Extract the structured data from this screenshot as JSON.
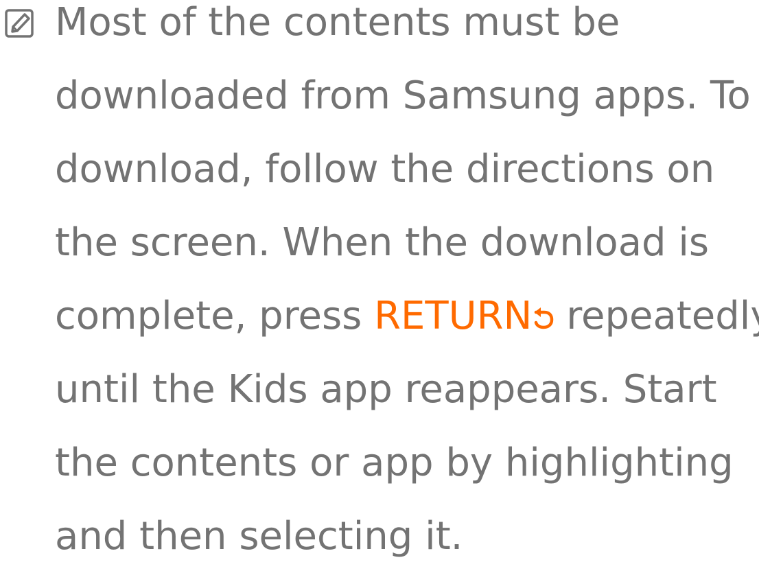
{
  "note": {
    "icon": "memo-pencil-icon",
    "colors": {
      "text": "#737373",
      "accent": "#ff6a00"
    },
    "lines": [
      "Most of the contents must be",
      "downloaded from Samsung apps. To",
      "download, follow the directions on",
      "the screen. When the download is",
      "repeatedly",
      "until the Kids app reappears. Start",
      "the contents or app by highlighting",
      "and then selecting it."
    ],
    "line5_prefix": "complete, press ",
    "return_key_label": "RETURN",
    "return_icon": "return-arrow-icon"
  }
}
